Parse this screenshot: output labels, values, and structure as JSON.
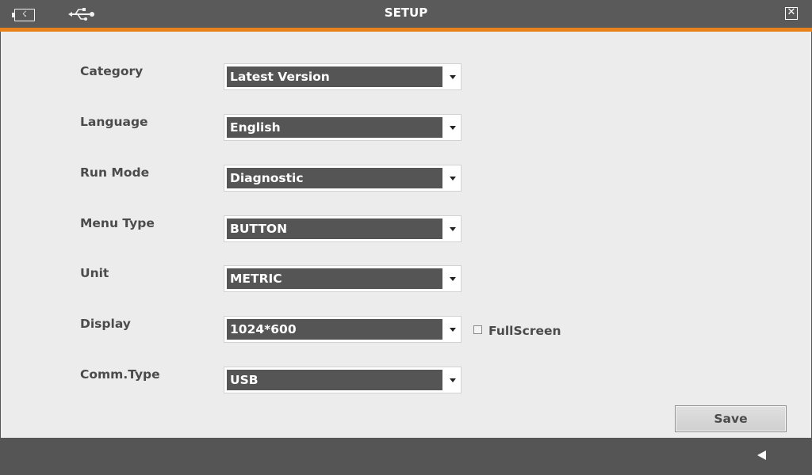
{
  "window": {
    "title": "SETUP",
    "icons": [
      "battery-icon",
      "usb-icon",
      "close-icon"
    ],
    "accent_color": "#e8821c"
  },
  "settings": [
    {
      "label": "Category",
      "value": "Latest Version"
    },
    {
      "label": "Language",
      "value": "English"
    },
    {
      "label": "Run Mode",
      "value": "Diagnostic"
    },
    {
      "label": "Menu Type",
      "value": "BUTTON"
    },
    {
      "label": "Unit",
      "value": "METRIC"
    },
    {
      "label": "Display",
      "value": "1024*600"
    },
    {
      "label": "Comm.Type",
      "value": "USB"
    }
  ],
  "fullscreen": {
    "label": "FullScreen",
    "checked": false
  },
  "actions": {
    "save_label": "Save"
  },
  "footer": {
    "back_icon": "back-arrow-icon"
  }
}
